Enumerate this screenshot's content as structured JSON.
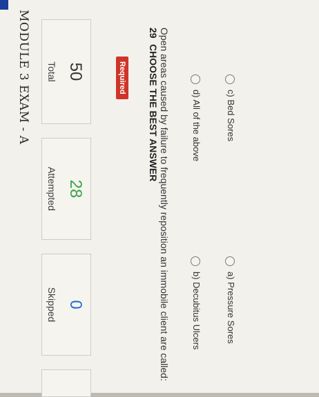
{
  "exam": {
    "title": "MODULE 3 EXAM - A"
  },
  "stats": {
    "total": {
      "value": "50",
      "label": "Total"
    },
    "attempted": {
      "value": "28",
      "label": "Attempted"
    },
    "skipped": {
      "value": "0",
      "label": "Skipped"
    }
  },
  "question": {
    "required_label": "Required",
    "number": "29",
    "heading": "CHOOSE THE BEST ANSWER",
    "text": "Open areas caused by failure to frequently reposition an immobile client are called:",
    "options": [
      {
        "label": "d) All of the above"
      },
      {
        "label": "b) Decubitus Ulcers"
      },
      {
        "label": "c) Bed Sores"
      },
      {
        "label": "a) Pressure Sores"
      }
    ]
  },
  "colors": {
    "accent_bar": "#1a3f9a",
    "attempted": "#3aa34a",
    "skipped": "#1f6fd1",
    "required_badge": "#cf3429"
  }
}
